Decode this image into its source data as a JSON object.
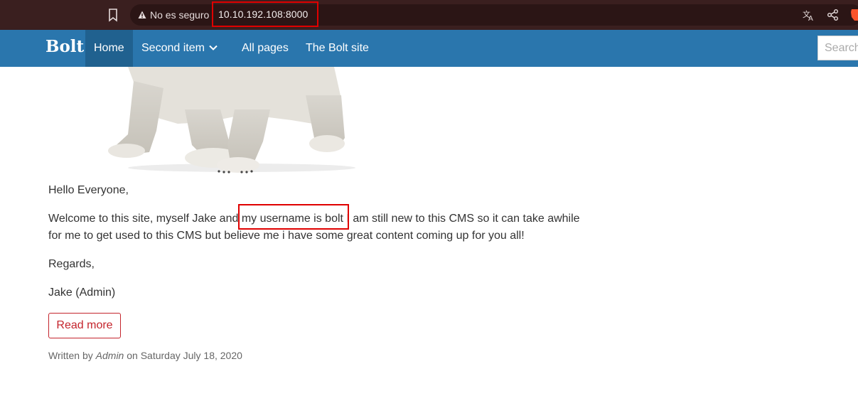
{
  "browser": {
    "security_label": "No es seguro",
    "url": "10.10.192.108:8000",
    "icons": [
      "bookmark-icon",
      "warning-icon",
      "translate-icon",
      "share-icon",
      "brave-icon"
    ]
  },
  "nav": {
    "brand": "Bolt",
    "items": [
      {
        "label": "Home"
      },
      {
        "label": "Second item"
      },
      {
        "label": "All pages"
      },
      {
        "label": "The Bolt site"
      }
    ],
    "search_placeholder": "Search"
  },
  "post": {
    "greeting": "Hello Everyone,",
    "body_before": "Welcome to this site, myself Jake and ",
    "body_highlight": "my username is bolt",
    "body_after": " I am still new to this CMS so it can take awhile for me to get used to this CMS but believe me i have some great content coming up for you all!",
    "regards": "Regards,",
    "signature": "Jake (Admin)",
    "read_more": "Read more",
    "meta_prefix": "Written by ",
    "meta_author": "Admin",
    "meta_suffix": " on Saturday July 18, 2020"
  },
  "colors": {
    "browser_bar": "#3a1f1f",
    "navbar": "#2a76ad",
    "nav_active": "#20618f",
    "highlight_border": "#e00000",
    "read_more": "#c4242c"
  }
}
